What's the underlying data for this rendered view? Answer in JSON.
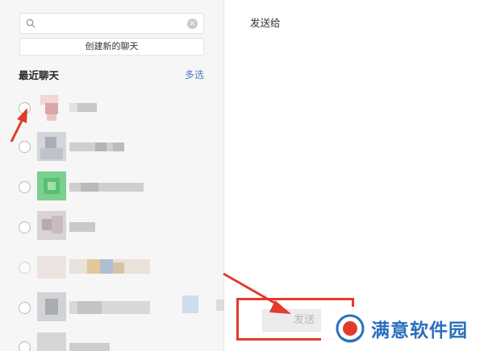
{
  "search": {
    "value": "",
    "placeholder": ""
  },
  "create_chat_label": "创建新的聊天",
  "recent": {
    "title": "最近聊天",
    "multi_select_label": "多选"
  },
  "chats": [
    {
      "selected": false
    },
    {
      "selected": false
    },
    {
      "selected": false
    },
    {
      "selected": false
    },
    {
      "selected": false
    },
    {
      "selected": false
    },
    {
      "selected": false
    }
  ],
  "right": {
    "send_to_label": "发送给",
    "send_button_label": "发送"
  },
  "watermark": {
    "text": "满意软件园"
  },
  "colors": {
    "annotation": "#e23b2c",
    "link": "#4a7fc1",
    "watermark": "#2a6fbe"
  },
  "icons": [
    "search-icon",
    "clear-icon",
    "radio-icon",
    "arrow-annotation",
    "logo-icon"
  ]
}
